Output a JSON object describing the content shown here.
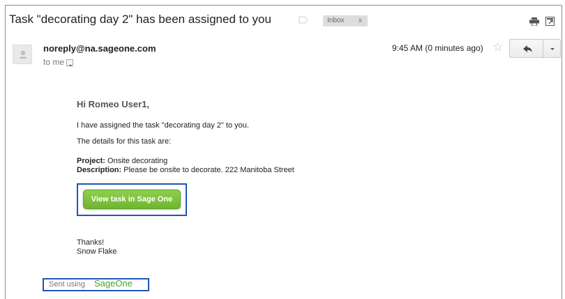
{
  "email": {
    "subject": "Task \"decorating day 2\" has been assigned to you",
    "label": "Inbox",
    "label_close": "x",
    "sender": "noreply@na.sageone.com",
    "recipient_line": "to me",
    "time": "9:45 AM (0 minutes ago)"
  },
  "body": {
    "greeting": "Hi Romeo User1,",
    "line1": "I have assigned the task \"decorating day 2\" to you.",
    "line2": "The details for this task are:",
    "project_label": "Project:",
    "project_value": "Onsite decorating",
    "description_label": "Description:",
    "description_value": "Please be onsite to decorate. 222 Manitoba Street",
    "button_label": "View task in Sage One",
    "thanks": "Thanks!",
    "signer": "Snow Flake",
    "footer_prefix": "Sent using",
    "footer_brand": "SageOne"
  },
  "icons": {
    "star": "star-icon",
    "reply": "reply-icon",
    "more": "chevron-down-icon",
    "print": "print-icon",
    "new_window": "new-window-icon",
    "avatar": "avatar-icon",
    "label_tag": "label-tag-icon"
  },
  "colors": {
    "button_green": "#7dc242",
    "highlight_blue": "#2155b5",
    "brand_green": "#41a62a"
  }
}
